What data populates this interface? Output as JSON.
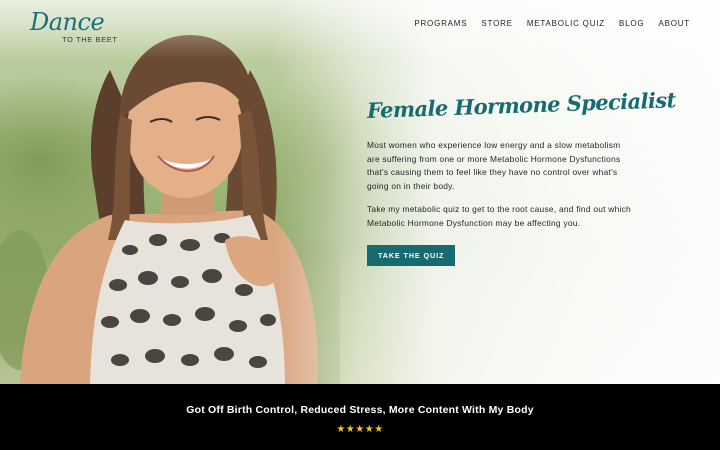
{
  "logo": {
    "script": "Dance",
    "subtitle": "TO THE BEET"
  },
  "nav": {
    "items": [
      {
        "label": "PROGRAMS"
      },
      {
        "label": "STORE"
      },
      {
        "label": "METABOLIC QUIZ"
      },
      {
        "label": "BLOG"
      },
      {
        "label": "ABOUT"
      }
    ]
  },
  "hero": {
    "headline": "Female Hormone Specialist",
    "paragraph1": "Most women who experience low energy and a slow metabolism are suffering from one or more Metabolic Hormone Dysfunctions that's causing them to feel like they have no control over what's going on in their body.",
    "paragraph2": "Take my metabolic quiz to get to the root cause, and find out which Metabolic Hormone Dysfunction may be affecting you.",
    "cta_label": "TAKE THE QUIZ"
  },
  "testimonial": {
    "quote": "Got Off Birth Control, Reduced Stress, More Content With My Body",
    "stars_text": "★★★★★",
    "rating": 5
  },
  "colors": {
    "brand_teal": "#176a70",
    "headline_teal": "#166b71",
    "star_gold": "#f2c230",
    "band_black": "#000000"
  }
}
